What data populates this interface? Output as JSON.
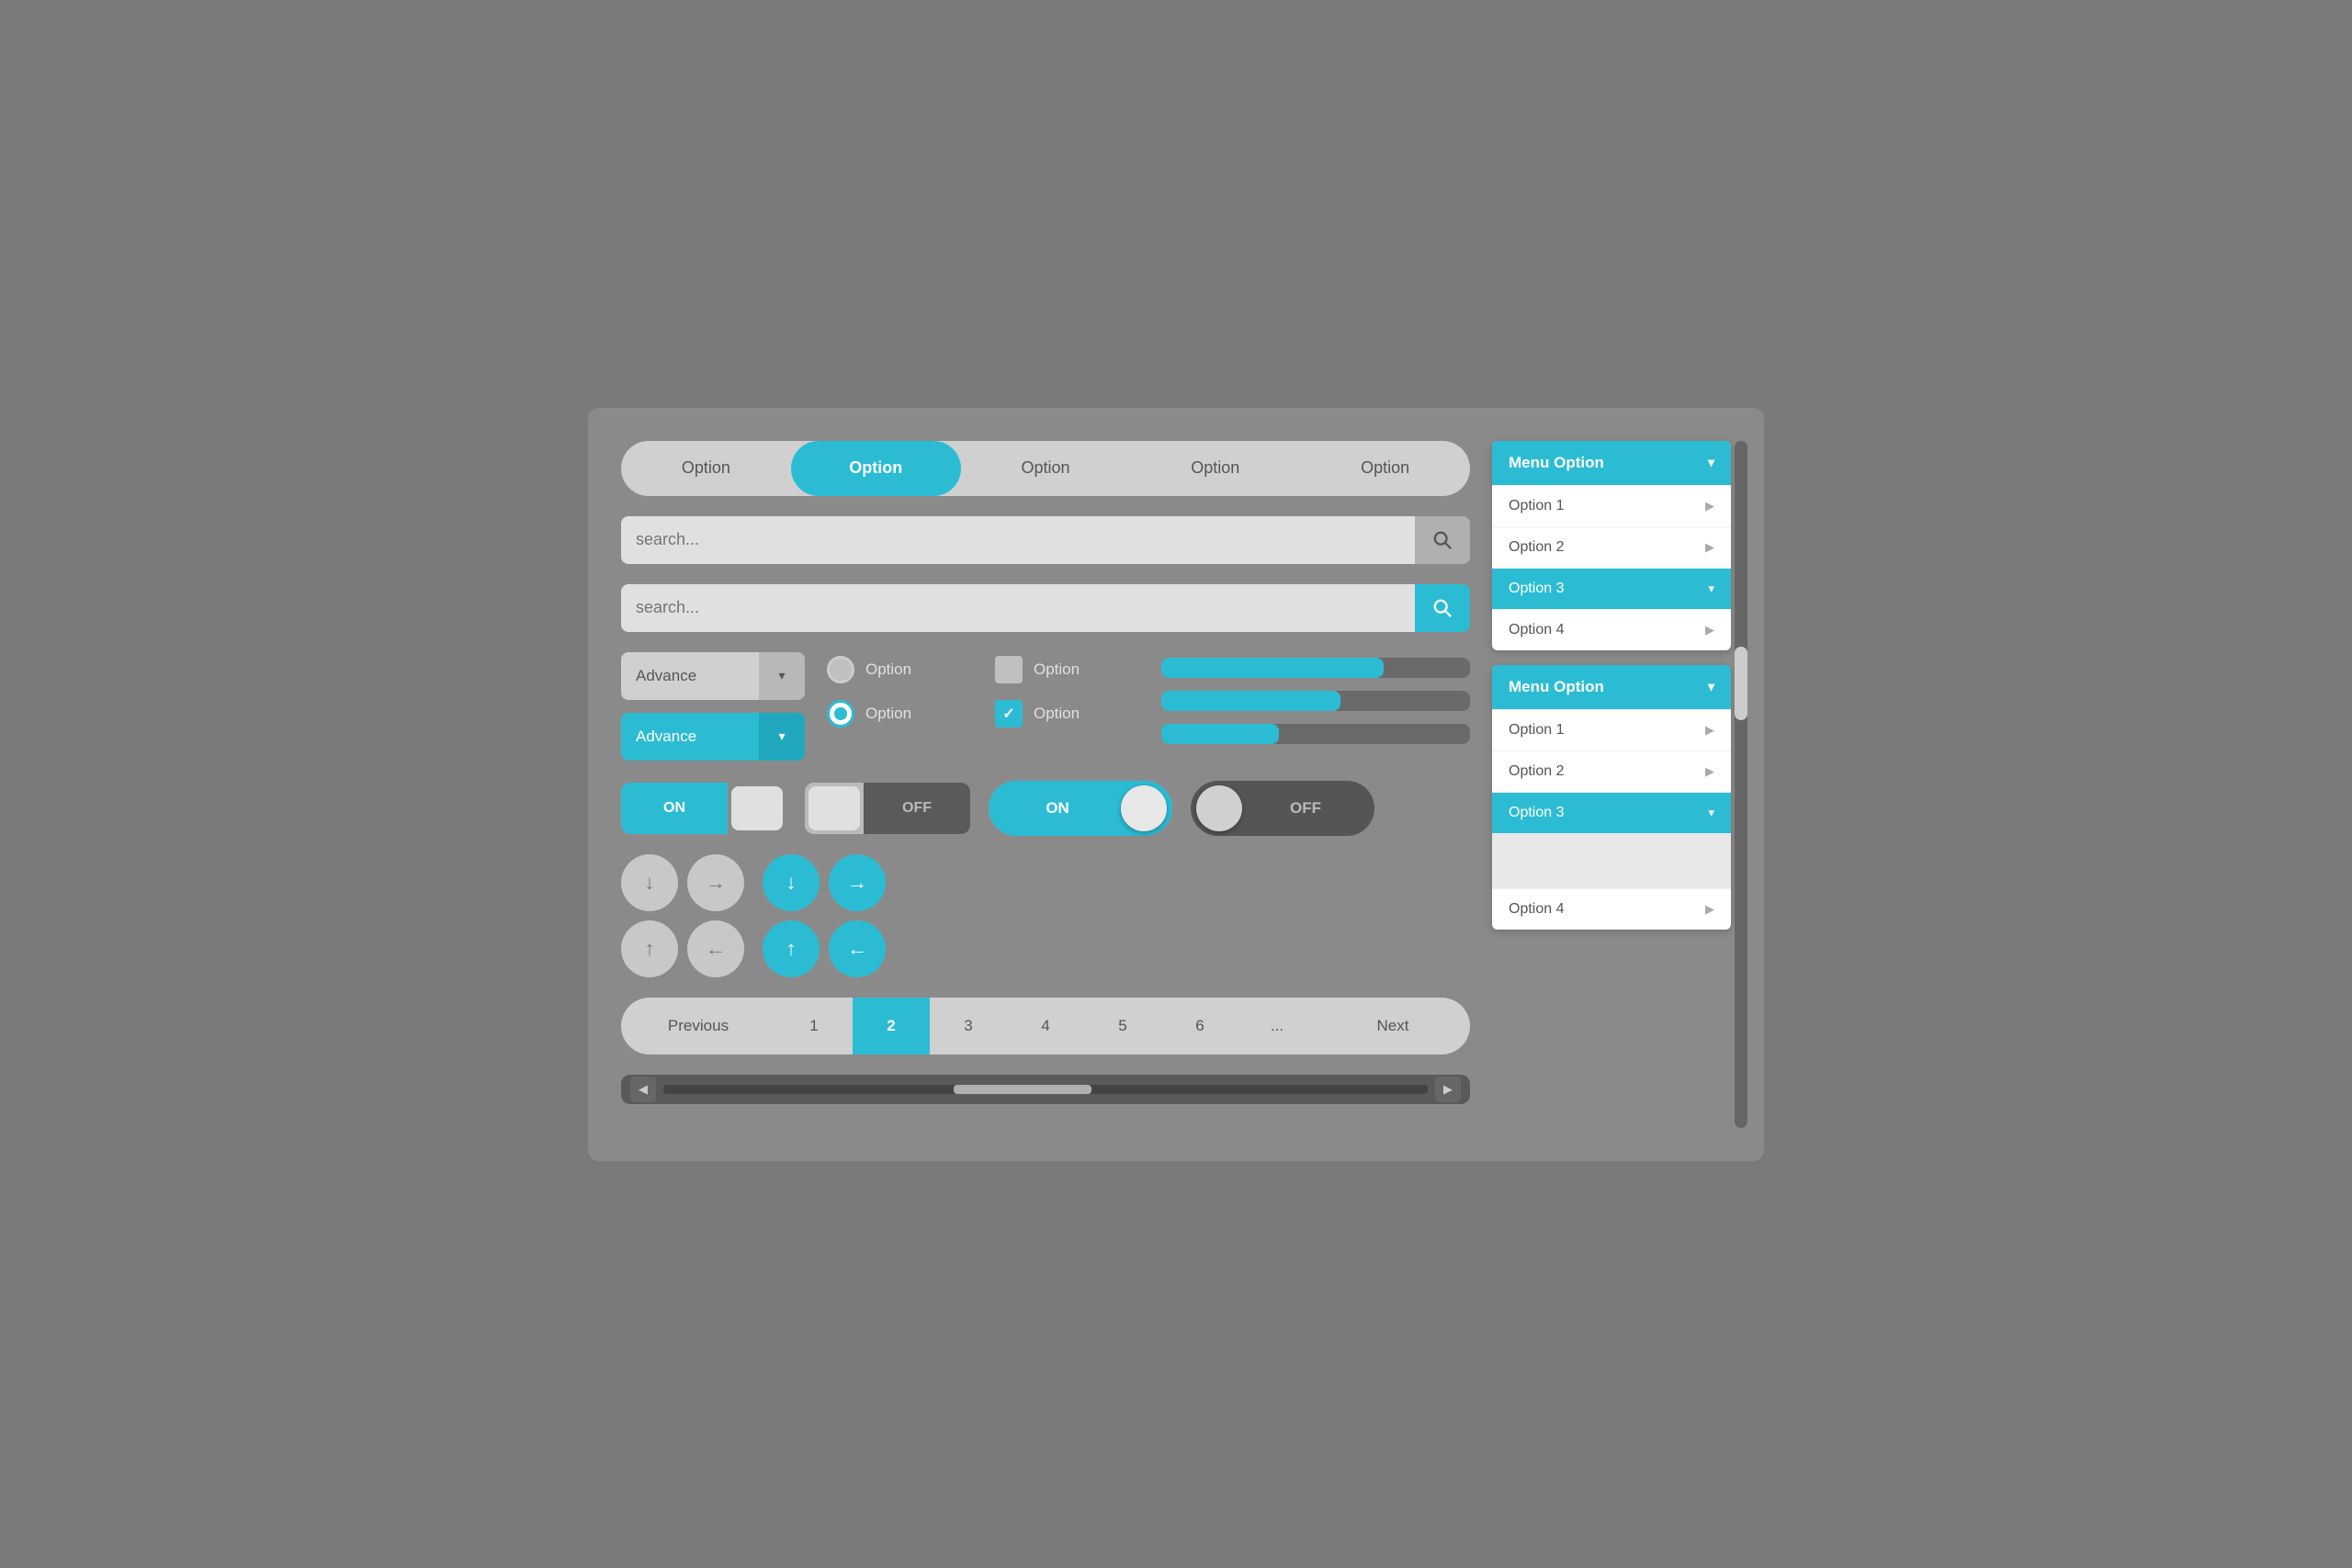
{
  "tabs": {
    "items": [
      "Option",
      "Option",
      "Option",
      "Option",
      "Option"
    ],
    "active_index": 1
  },
  "search": {
    "placeholder1": "search...",
    "placeholder2": "search...",
    "icon": "🔍"
  },
  "dropdowns": {
    "gray_label": "Advance",
    "blue_label": "Advance"
  },
  "radio_options": [
    {
      "label": "Option",
      "checked": false,
      "type": "radio"
    },
    {
      "label": "Option",
      "checked": false,
      "type": "checkbox"
    },
    {
      "label": "Option",
      "checked": true,
      "type": "radio"
    },
    {
      "label": "Option",
      "checked": true,
      "type": "checkbox"
    }
  ],
  "progress_bars": [
    {
      "fill": 72
    },
    {
      "fill": 58
    },
    {
      "fill": 38
    }
  ],
  "toggle_on": {
    "on_label": "ON",
    "off_label": "OFF"
  },
  "pagination": {
    "prev": "Previous",
    "next": "Next",
    "pages": [
      "1",
      "2",
      "3",
      "4",
      "5",
      "6",
      "..."
    ],
    "active": "2"
  },
  "menu1": {
    "header": "Menu Option",
    "items": [
      {
        "label": "Option 1",
        "active": false
      },
      {
        "label": "Option 2",
        "active": false
      },
      {
        "label": "Option 3",
        "active": true
      },
      {
        "label": "Option 4",
        "active": false
      }
    ]
  },
  "menu2": {
    "header": "Menu Option",
    "items": [
      {
        "label": "Option 1",
        "active": false
      },
      {
        "label": "Option 2",
        "active": false
      },
      {
        "label": "Option 3",
        "active": true
      },
      {
        "label": "Option 4",
        "active": false
      }
    ]
  },
  "colors": {
    "accent": "#2bbcd4",
    "bg": "#7a7a7a"
  }
}
